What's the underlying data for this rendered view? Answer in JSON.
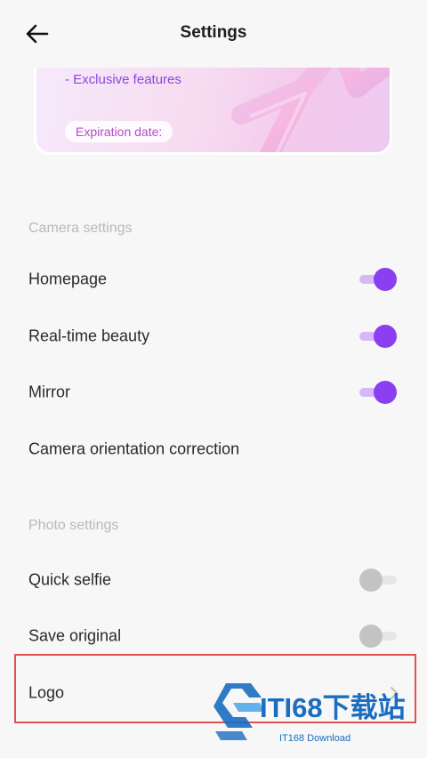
{
  "header": {
    "title": "Settings"
  },
  "vip": {
    "feature_line": "- Exclusive features",
    "expiration_label": "Expiration date:"
  },
  "camera_section": {
    "title": "Camera settings",
    "items": [
      {
        "label": "Homepage",
        "toggle": "on"
      },
      {
        "label": "Real-time beauty",
        "toggle": "on"
      },
      {
        "label": "Mirror",
        "toggle": "on"
      },
      {
        "label": "Camera orientation correction"
      }
    ]
  },
  "photo_section": {
    "title": "Photo settings",
    "items": [
      {
        "label": "Quick selfie",
        "toggle": "off"
      },
      {
        "label": "Save original",
        "toggle": "off"
      },
      {
        "label": "Logo",
        "action": "chevron"
      }
    ]
  },
  "watermark": {
    "brand": "ITI68下载站",
    "sub": "IT168 Download"
  },
  "colors": {
    "accent": "#8a3ff0",
    "accent_light": "#d5b8f6",
    "highlight": "#e05252",
    "watermark": "#1a6dc0"
  },
  "icons": [
    "back-arrow-icon",
    "chevron-right-icon",
    "toggle-switch-icon"
  ]
}
